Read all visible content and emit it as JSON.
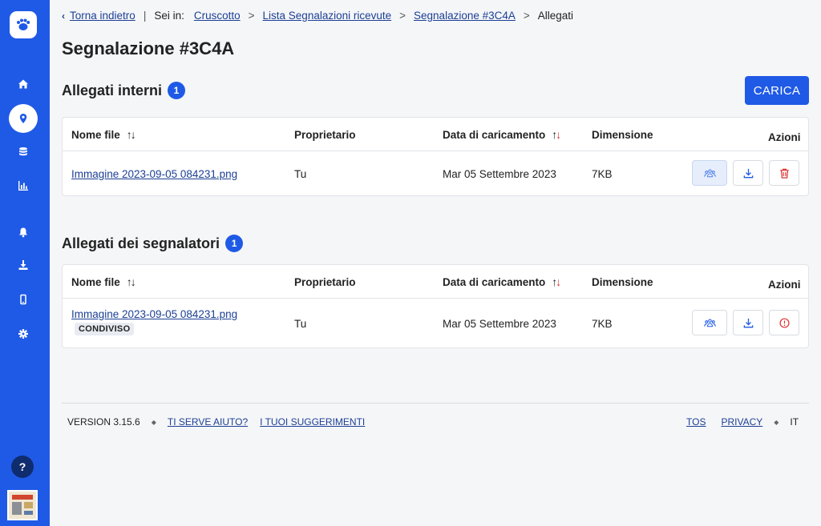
{
  "breadcrumb": {
    "back_label": "Torna indietro",
    "you_are_in": "Sei in:",
    "items": [
      "Cruscotto",
      "Lista Segnalazioni ricevute",
      "Segnalazione #3C4A"
    ],
    "current": "Allegati",
    "separator": ">",
    "divider": "|"
  },
  "page": {
    "title": "Segnalazione #3C4A"
  },
  "upload_button": "CARICA",
  "internal": {
    "title": "Allegati interni",
    "count": "1",
    "columns": [
      "Nome file",
      "Proprietario",
      "Data di caricamento",
      "Dimensione",
      "Azioni"
    ],
    "rows": [
      {
        "file": "Immagine 2023-09-05 084231.png",
        "owner": "Tu",
        "date": "Mar 05 Settembre 2023",
        "size": "7KB"
      }
    ]
  },
  "reporters": {
    "title": "Allegati dei segnalatori",
    "count": "1",
    "columns": [
      "Nome file",
      "Proprietario",
      "Data di caricamento",
      "Dimensione",
      "Azioni"
    ],
    "rows": [
      {
        "file": "Immagine 2023-09-05 084231.png",
        "tag": "CONDIVISO",
        "owner": "Tu",
        "date": "Mar 05 Settembre 2023",
        "size": "7KB"
      }
    ]
  },
  "footer": {
    "version": "VERSION 3.15.6",
    "help": "TI SERVE AIUTO?",
    "suggestions": "I TUOI SUGGERIMENTI",
    "tos": "TOS",
    "privacy": "PRIVACY",
    "lang": "IT"
  },
  "sidebar": {
    "help_label": "?",
    "icons": [
      "home-icon",
      "map-pin-icon",
      "database-icon",
      "chart-icon",
      "bell-icon",
      "download-icon",
      "mobile-icon",
      "gear-icon"
    ]
  },
  "colors": {
    "accent": "#1f5ae6",
    "link": "#1c3f94",
    "danger": "#d33",
    "sidebar_dark": "#0f2c6e"
  }
}
